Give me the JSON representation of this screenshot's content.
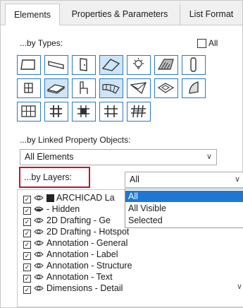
{
  "tabs": [
    "Elements",
    "Properties & Parameters",
    "List Format"
  ],
  "by_types": {
    "label": "...by Types:",
    "all_label": "All",
    "type_icons": [
      [
        "wall-type-icon",
        "beam-type-icon",
        "door-type-icon",
        "roof-type-icon",
        "lamp-type-icon",
        "mesh-type-icon",
        "column-type-icon"
      ],
      [
        "window-type-icon",
        "slab-type-icon",
        "object-type-icon",
        "shell-type-icon",
        "stair-type-icon",
        "zone-type-icon",
        "morph-type-icon"
      ],
      [
        "curtain-wall-type-icon",
        "railing-type-icon",
        "panel-type-icon",
        "frame-type-icon",
        "accessory-type-icon"
      ]
    ]
  },
  "linked_property": {
    "label": "...by Linked Property Objects:",
    "selected": "All Elements"
  },
  "by_layers": {
    "label": "...by Layers:",
    "selected": "All",
    "options": [
      "All",
      "All Visible",
      "Selected"
    ],
    "highlighted_option": "All"
  },
  "layers": [
    {
      "name": "ARCHICAD La",
      "visible": true,
      "checked": true,
      "special": "archicad"
    },
    {
      "name": "- Hidden",
      "visible": false,
      "checked": true
    },
    {
      "name": "2D Drafting - Ge",
      "visible": true,
      "checked": true
    },
    {
      "name": "2D Drafting - Hotspot",
      "visible": true,
      "checked": true
    },
    {
      "name": "Annotation - General",
      "visible": true,
      "checked": true
    },
    {
      "name": "Annotation - Label",
      "visible": true,
      "checked": true
    },
    {
      "name": "Annotation - Structure",
      "visible": true,
      "checked": true
    },
    {
      "name": "Annotation - Text",
      "visible": true,
      "checked": true
    },
    {
      "name": "Dimensions - Detail",
      "visible": true,
      "checked": true
    }
  ],
  "colors": {
    "accent": "#2a79c7",
    "highlight": "#1e78d3",
    "callout": "#c0172a"
  }
}
